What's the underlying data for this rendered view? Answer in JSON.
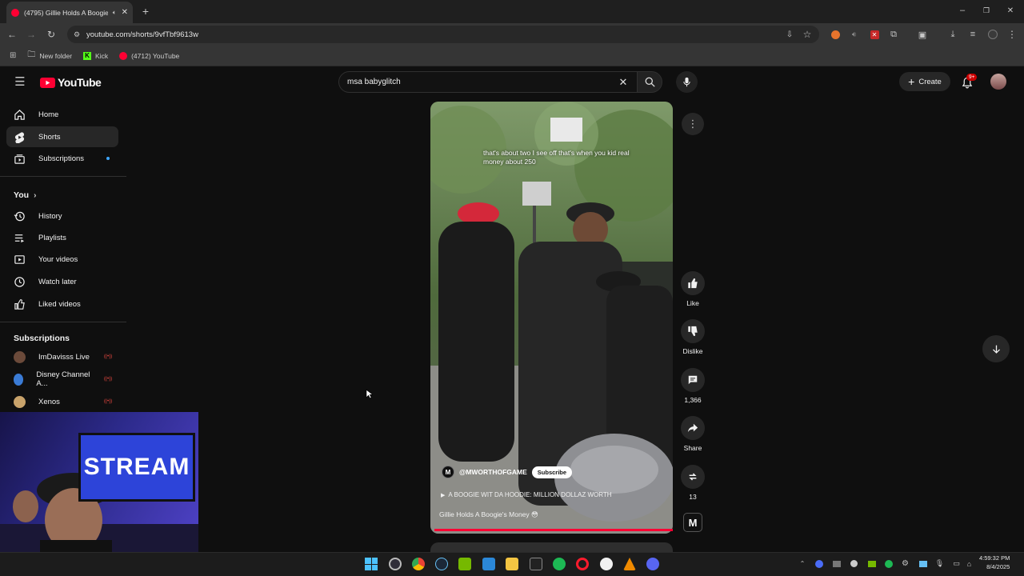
{
  "browser": {
    "tab_title": "(4795) Gillie Holds A Boogie's...",
    "url": "youtube.com/shorts/9vfTbf9613w",
    "bookmarks": [
      {
        "label": "New folder"
      },
      {
        "label": "Kick"
      },
      {
        "label": "(4712) YouTube"
      }
    ]
  },
  "header": {
    "logo": "YouTube",
    "search_value": "msa babyglitch",
    "create_label": "Create",
    "notifications_badge": "9+"
  },
  "sidebar": {
    "main": [
      {
        "label": "Home",
        "icon": "home-icon"
      },
      {
        "label": "Shorts",
        "icon": "shorts-icon"
      },
      {
        "label": "Subscriptions",
        "icon": "subscriptions-icon"
      }
    ],
    "you_title": "You",
    "you": [
      {
        "label": "History",
        "icon": "history-icon"
      },
      {
        "label": "Playlists",
        "icon": "playlists-icon"
      },
      {
        "label": "Your videos",
        "icon": "your-videos-icon"
      },
      {
        "label": "Watch later",
        "icon": "watch-later-icon"
      },
      {
        "label": "Liked videos",
        "icon": "liked-videos-icon"
      }
    ],
    "subscriptions_title": "Subscriptions",
    "subscriptions": [
      {
        "label": "ImDavisss Live",
        "color": "#6b4a3a"
      },
      {
        "label": "Disney Channel A...",
        "color": "#3a7bd5"
      },
      {
        "label": "Xenos",
        "color": "#c9a36b"
      }
    ]
  },
  "short": {
    "caption": "that's about two I see off that's when you kid real money about 250",
    "channel": "@MWORTHOFGAME",
    "subscribe_label": "Subscribe",
    "music": "A BOOGIE WIT DA HOODIE: MILLION DOLLAZ WORTH",
    "description": "Gillie Holds A Boogie's Money 😳"
  },
  "actions": {
    "like_label": "Like",
    "dislike_label": "Dislike",
    "comments_count": "1,366",
    "share_label": "Share",
    "remix_count": "13"
  },
  "webcam": {
    "sign_text": "STREAM"
  },
  "taskbar": {
    "time": "4:59:32 PM",
    "date": "8/4/2025"
  },
  "colors": {
    "accent_red": "#ff0033",
    "background": "#0f0f0f",
    "chip": "#272727"
  }
}
